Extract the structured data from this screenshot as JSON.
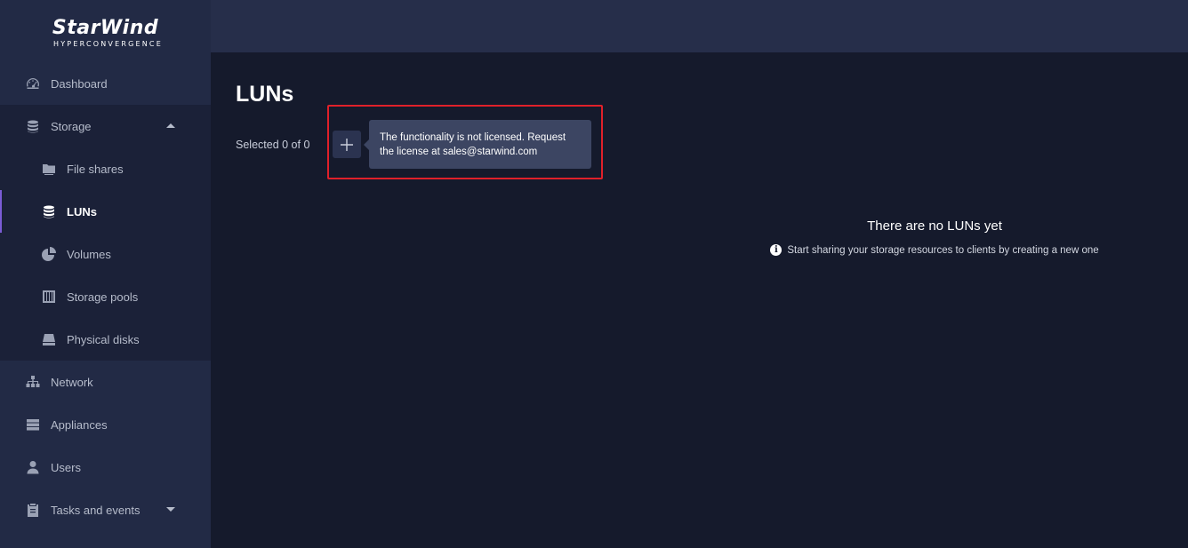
{
  "brand": {
    "name": "StarWind",
    "tagline": "HYPERCONVERGENCE"
  },
  "sidebar": {
    "items": [
      {
        "label": "Dashboard",
        "icon": "dashboard-icon"
      },
      {
        "label": "Storage",
        "icon": "database-icon",
        "expanded": true
      },
      {
        "label": "File shares",
        "icon": "folder-icon"
      },
      {
        "label": "LUNs",
        "icon": "database-icon",
        "active": true
      },
      {
        "label": "Volumes",
        "icon": "pie-chart-icon"
      },
      {
        "label": "Storage pools",
        "icon": "storage-pool-icon"
      },
      {
        "label": "Physical disks",
        "icon": "hard-disk-icon"
      },
      {
        "label": "Network",
        "icon": "network-icon"
      },
      {
        "label": "Appliances",
        "icon": "server-icon"
      },
      {
        "label": "Users",
        "icon": "user-icon"
      },
      {
        "label": "Tasks and events",
        "icon": "clipboard-icon",
        "expanded": false
      }
    ]
  },
  "main": {
    "title": "LUNs",
    "selected_text": "Selected 0 of 0",
    "tooltip": "The functionality is not licensed. Request the license at sales@starwind.com",
    "empty_title": "There are no LUNs yet",
    "empty_hint": "Start sharing your storage resources to clients by creating a new one"
  },
  "colors": {
    "accent": "#7b5cd6",
    "highlight": "#e0202a",
    "sidebar_bg": "#222a45",
    "main_bg": "#151a2c"
  }
}
